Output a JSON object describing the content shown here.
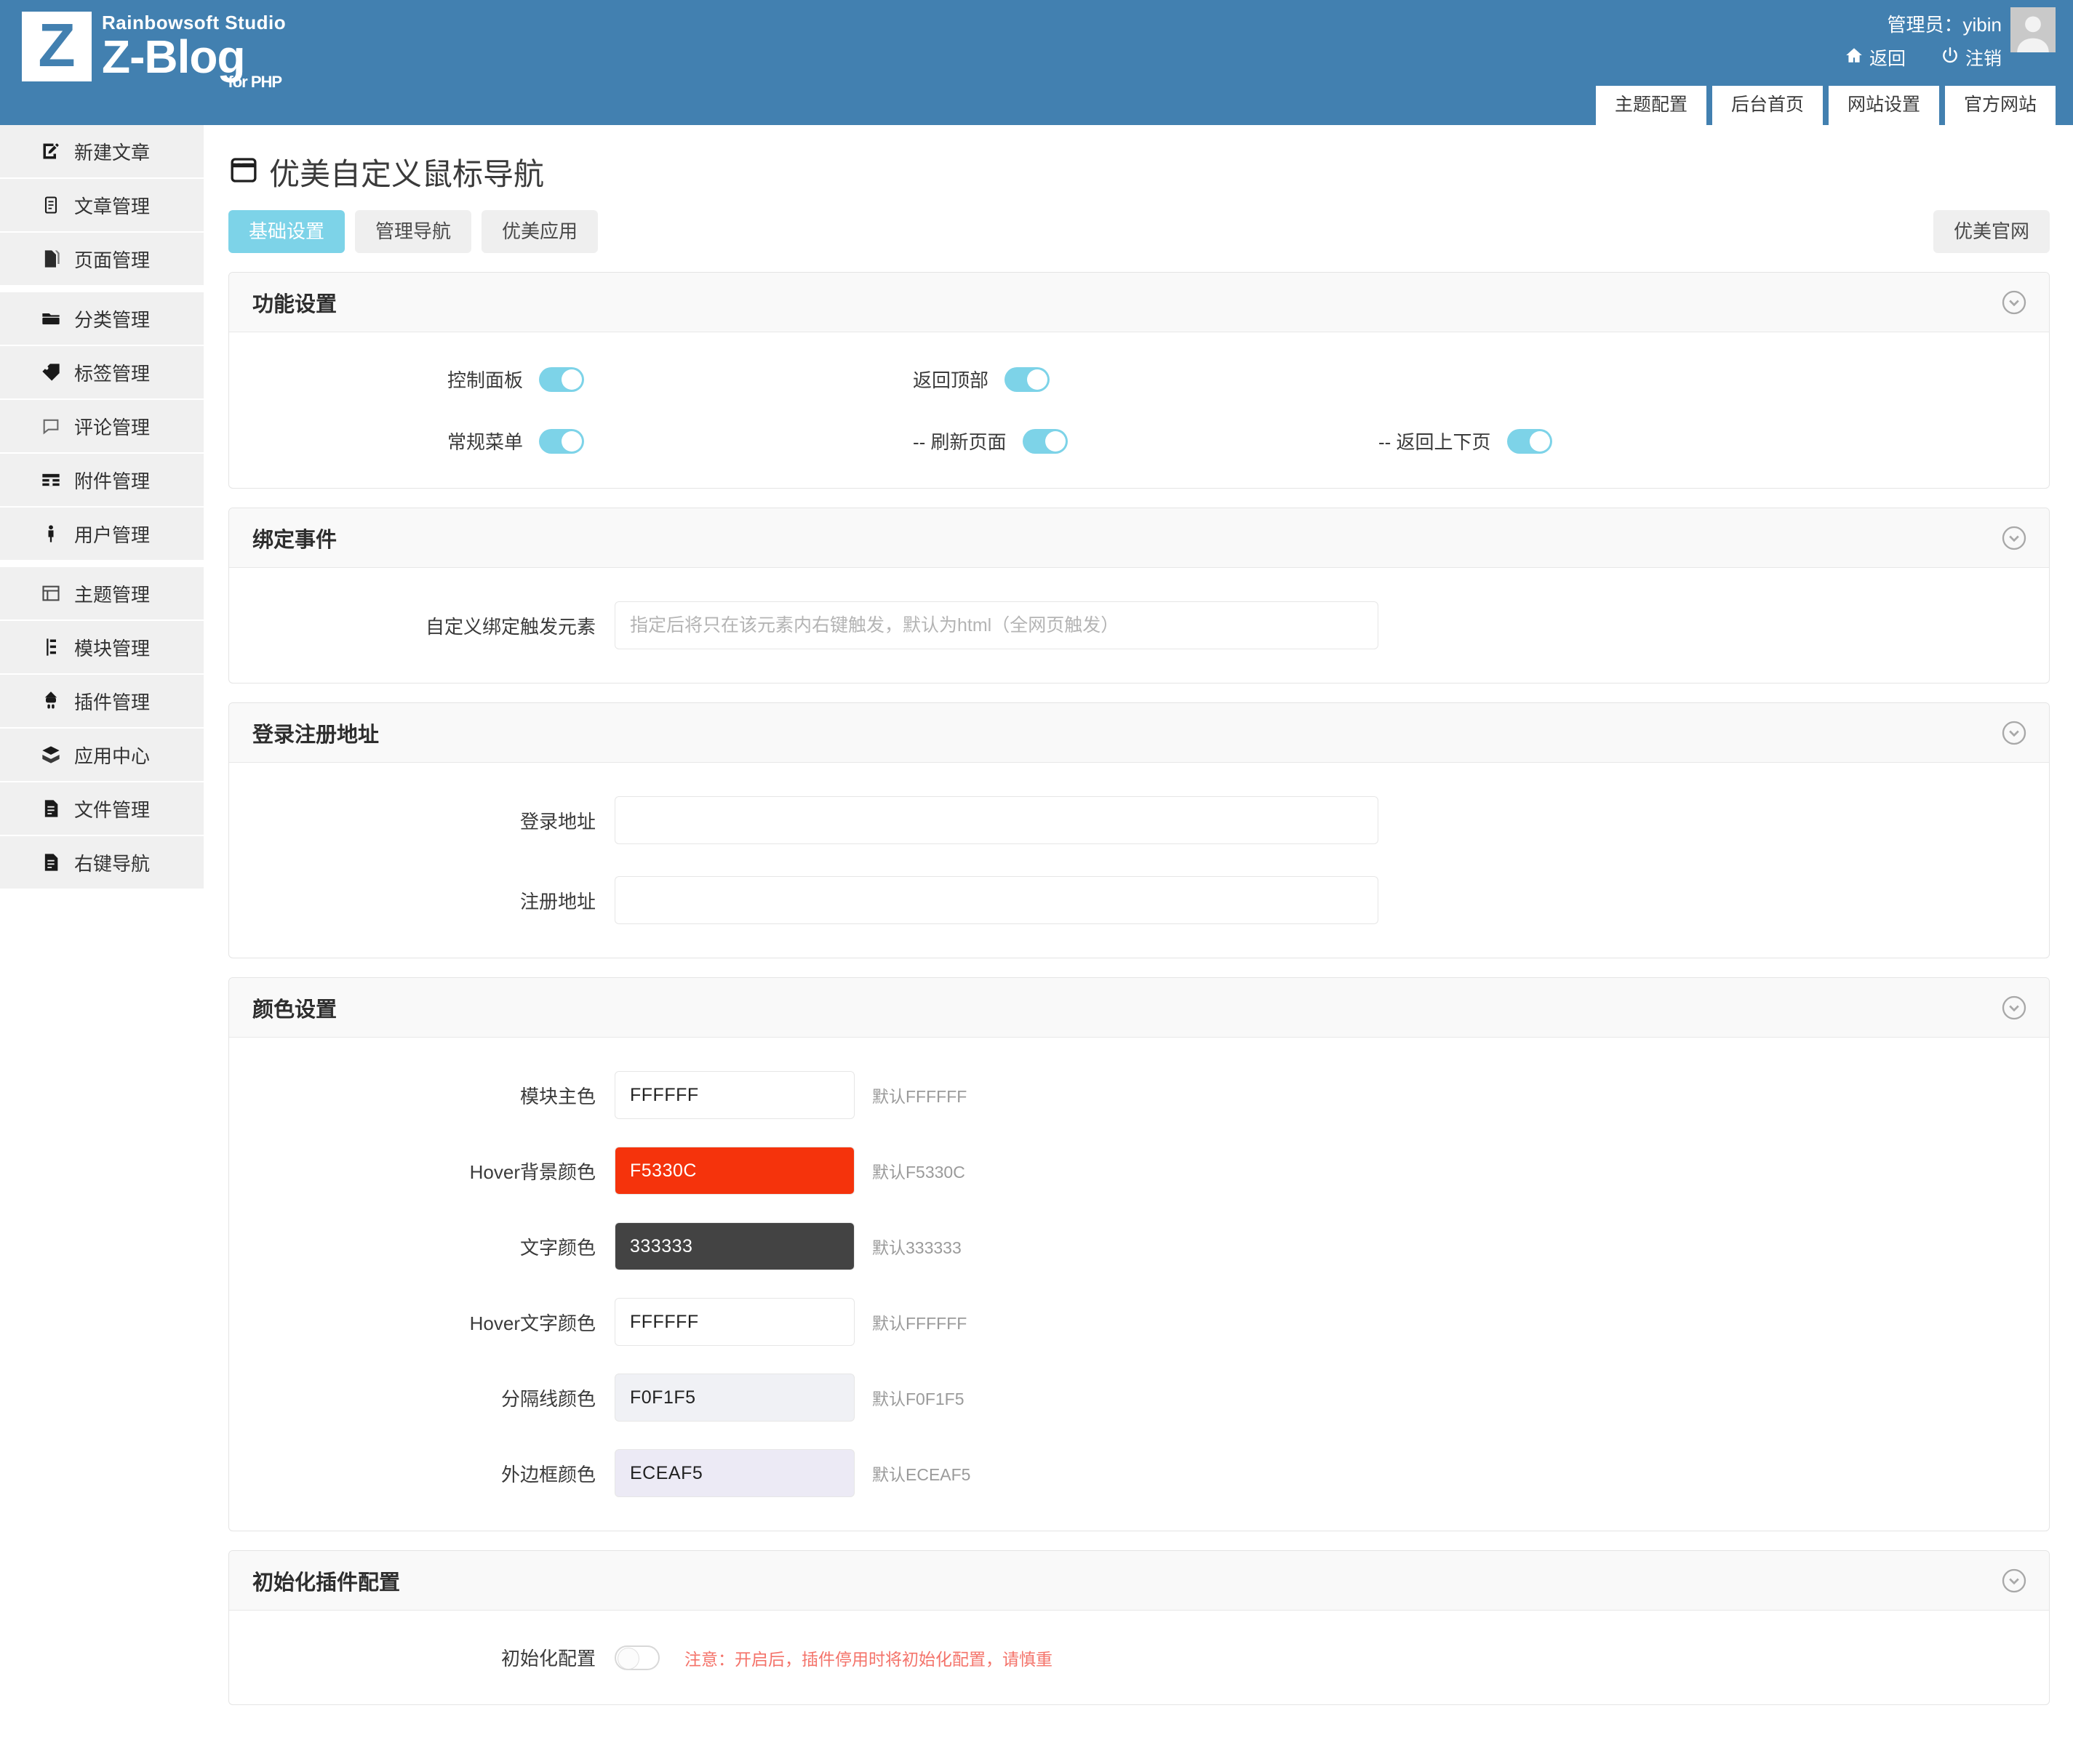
{
  "header": {
    "logo": {
      "studio": "Rainbowsoft Studio",
      "brand": "Z-Blog",
      "suffix": "for PHP",
      "mark": "Z"
    },
    "user_label": "管理员：yibin",
    "links": [
      {
        "label": "返回",
        "icon": "home-icon"
      },
      {
        "label": "注销",
        "icon": "power-icon"
      }
    ],
    "nav_tabs": [
      {
        "label": "主题配置"
      },
      {
        "label": "后台首页"
      },
      {
        "label": "网站设置"
      },
      {
        "label": "官方网站"
      }
    ]
  },
  "sidebar": {
    "items": [
      {
        "label": "新建文章",
        "icon": "compose-icon"
      },
      {
        "label": "文章管理",
        "icon": "article-icon"
      },
      {
        "label": "页面管理",
        "icon": "page-icon"
      },
      {
        "label": "分类管理",
        "icon": "folder-icon"
      },
      {
        "label": "标签管理",
        "icon": "tag-icon"
      },
      {
        "label": "评论管理",
        "icon": "comment-icon"
      },
      {
        "label": "附件管理",
        "icon": "attachment-icon"
      },
      {
        "label": "用户管理",
        "icon": "user-icon"
      },
      {
        "label": "主题管理",
        "icon": "theme-icon"
      },
      {
        "label": "模块管理",
        "icon": "module-icon"
      },
      {
        "label": "插件管理",
        "icon": "plugin-icon"
      },
      {
        "label": "应用中心",
        "icon": "appstore-icon"
      },
      {
        "label": "文件管理",
        "icon": "file-icon"
      },
      {
        "label": "右键导航",
        "icon": "file-icon"
      }
    ]
  },
  "page": {
    "title": "优美自定义鼠标导航",
    "title_icon": "window-icon",
    "tabs": [
      {
        "label": "基础设置",
        "active": true
      },
      {
        "label": "管理导航",
        "active": false
      },
      {
        "label": "优美应用",
        "active": false
      }
    ],
    "official_button": "优美官网"
  },
  "panels": {
    "function": {
      "title": "功能设置",
      "collapse_icon": "chevron-down-circle-icon",
      "toggles": [
        {
          "label": "控制面板",
          "on": true
        },
        {
          "label": "返回顶部",
          "on": true
        },
        {
          "label": "常规菜单",
          "on": true
        },
        {
          "label": "-- 刷新页面",
          "on": true
        },
        {
          "label": "-- 返回上下页",
          "on": true
        }
      ]
    },
    "bind": {
      "title": "绑定事件",
      "collapse_icon": "chevron-down-circle-icon",
      "field": {
        "label": "自定义绑定触发元素",
        "value": "",
        "placeholder": "指定后将只在该元素内右键触发，默认为html（全网页触发）"
      }
    },
    "auth": {
      "title": "登录注册地址",
      "collapse_icon": "chevron-down-circle-icon",
      "fields": [
        {
          "label": "登录地址",
          "value": "",
          "placeholder": ""
        },
        {
          "label": "注册地址",
          "value": "",
          "placeholder": ""
        }
      ]
    },
    "color": {
      "title": "颜色设置",
      "collapse_icon": "chevron-down-circle-icon",
      "rows": [
        {
          "label": "模块主色",
          "value": "FFFFFF",
          "hint": "默认FFFFFF",
          "bg": "#FFFFFF",
          "fg": "#222222"
        },
        {
          "label": "Hover背景颜色",
          "value": "F5330C",
          "hint": "默认F5330C",
          "bg": "#F5330C",
          "fg": "#FFFFFF"
        },
        {
          "label": "文字颜色",
          "value": "333333",
          "hint": "默认333333",
          "bg": "#434343",
          "fg": "#FFFFFF"
        },
        {
          "label": "Hover文字颜色",
          "value": "FFFFFF",
          "hint": "默认FFFFFF",
          "bg": "#FFFFFF",
          "fg": "#222222"
        },
        {
          "label": "分隔线颜色",
          "value": "F0F1F5",
          "hint": "默认F0F1F5",
          "bg": "#F0F1F5",
          "fg": "#222222"
        },
        {
          "label": "外边框颜色",
          "value": "ECEAF5",
          "hint": "默认ECEAF5",
          "bg": "#ECEAF5",
          "fg": "#222222"
        }
      ]
    },
    "init": {
      "title": "初始化插件配置",
      "collapse_icon": "chevron-down-circle-icon",
      "toggle_label": "初始化配置",
      "toggle_on": false,
      "warning": "注意：开启后，插件停用时将初始化配置，请慎重"
    }
  },
  "colors": {
    "brand_blue": "#4280b0",
    "accent_cyan": "#7dd3e8",
    "warning_red": "#f4736a"
  }
}
